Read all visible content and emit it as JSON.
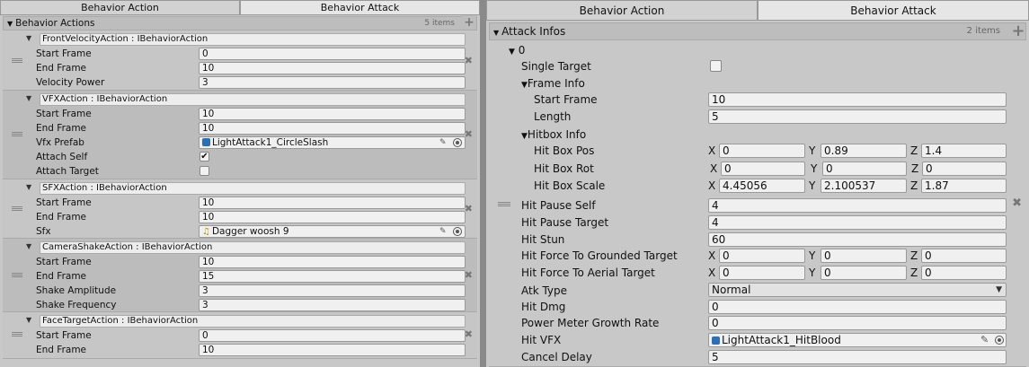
{
  "left": {
    "tabs": [
      "Behavior Action",
      "Behavior Attack"
    ],
    "list_title": "Behavior Actions",
    "count": "5 items",
    "plus": "+",
    "remove": "✖",
    "actions": [
      {
        "header": "FrontVelocityAction : IBehaviorAction",
        "fields": [
          [
            "Start Frame",
            "0"
          ],
          [
            "End Frame",
            "10"
          ],
          [
            "Velocity Power",
            "3"
          ]
        ]
      },
      {
        "header": "VFXAction : IBehaviorAction",
        "fields": [
          [
            "Start Frame",
            "10"
          ],
          [
            "End Frame",
            "10"
          ]
        ],
        "vfx_label": "Vfx Prefab",
        "vfx_value": "LightAttack1_CircleSlash",
        "attach_self": "Attach Self",
        "attach_target": "Attach Target"
      },
      {
        "header": "SFXAction : IBehaviorAction",
        "fields": [
          [
            "Start Frame",
            "10"
          ],
          [
            "End Frame",
            "10"
          ]
        ],
        "sfx_label": "Sfx",
        "sfx_value": "Dagger woosh 9"
      },
      {
        "header": "CameraShakeAction : IBehaviorAction",
        "fields": [
          [
            "Start Frame",
            "10"
          ],
          [
            "End Frame",
            "15"
          ],
          [
            "Shake Amplitude",
            "3"
          ],
          [
            "Shake Frequency",
            "3"
          ]
        ]
      },
      {
        "header": "FaceTargetAction : IBehaviorAction",
        "fields": [
          [
            "Start Frame",
            "0"
          ],
          [
            "End Frame",
            "10"
          ]
        ]
      }
    ]
  },
  "right": {
    "tabs": [
      "Behavior Action",
      "Behavior Attack"
    ],
    "list_title": "Attack Infos",
    "count": "2 items",
    "plus": "+",
    "remove": "✖",
    "element_index": "0",
    "single_target": "Single Target",
    "frame_info": "Frame Info",
    "start_frame": [
      "Start Frame",
      "10"
    ],
    "length": [
      "Length",
      "5"
    ],
    "hitbox_info": "Hitbox Info",
    "hitbox_pos": {
      "label": "Hit Box Pos",
      "x": "0",
      "y": "0.89",
      "z": "1.4"
    },
    "hitbox_rot": {
      "label": "Hit Box Rot",
      "x": "0",
      "y": "0",
      "z": "0"
    },
    "hitbox_scale": {
      "label": "Hit Box Scale",
      "x": "4.45056",
      "y": "2.100537",
      "z": "1.87"
    },
    "hit_pause_self": [
      "Hit Pause Self",
      "4"
    ],
    "hit_pause_target": [
      "Hit Pause Target",
      "4"
    ],
    "hit_stun": [
      "Hit Stun",
      "60"
    ],
    "force_grounded": {
      "label": "Hit Force To Grounded Target",
      "x": "0",
      "y": "0",
      "z": "0"
    },
    "force_aerial": {
      "label": "Hit Force To Aerial Target",
      "x": "0",
      "y": "0",
      "z": "0"
    },
    "atk_type": [
      "Atk Type",
      "Normal"
    ],
    "hit_dmg": [
      "Hit Dmg",
      "0"
    ],
    "power_meter": [
      "Power Meter Growth Rate",
      "0"
    ],
    "hit_vfx": [
      "Hit VFX",
      "LightAttack1_HitBlood"
    ],
    "cancel_delay": [
      "Cancel Delay",
      "5"
    ],
    "axes": [
      "X",
      "Y",
      "Z"
    ]
  }
}
